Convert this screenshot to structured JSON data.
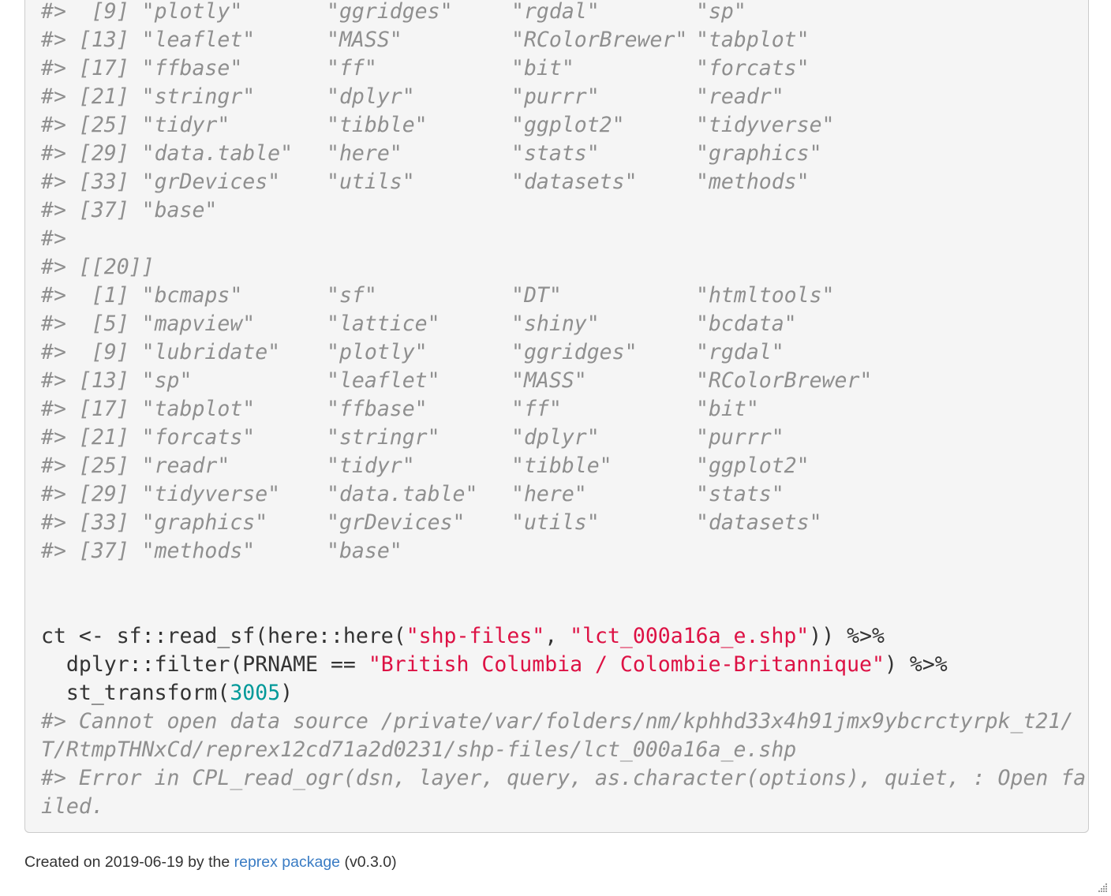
{
  "output_prefix": "#>",
  "output_rows_a": [
    {
      "index": " [9]",
      "items": [
        "\"plotly\"",
        "\"ggridges\"",
        "\"rgdal\"",
        "\"sp\""
      ]
    },
    {
      "index": "[13]",
      "items": [
        "\"leaflet\"",
        "\"MASS\"",
        "\"RColorBrewer\"",
        "\"tabplot\""
      ]
    },
    {
      "index": "[17]",
      "items": [
        "\"ffbase\"",
        "\"ff\"",
        "\"bit\"",
        "\"forcats\""
      ]
    },
    {
      "index": "[21]",
      "items": [
        "\"stringr\"",
        "\"dplyr\"",
        "\"purrr\"",
        "\"readr\""
      ]
    },
    {
      "index": "[25]",
      "items": [
        "\"tidyr\"",
        "\"tibble\"",
        "\"ggplot2\"",
        "\"tidyverse\""
      ]
    },
    {
      "index": "[29]",
      "items": [
        "\"data.table\"",
        "\"here\"",
        "\"stats\"",
        "\"graphics\""
      ]
    },
    {
      "index": "[33]",
      "items": [
        "\"grDevices\"",
        "\"utils\"",
        "\"datasets\"",
        "\"methods\""
      ]
    },
    {
      "index": "[37]",
      "items": [
        "\"base\"",
        "",
        "",
        ""
      ]
    }
  ],
  "output_blank": "#>",
  "output_list_header": "#> [[20]]",
  "output_rows_b": [
    {
      "index": " [1]",
      "items": [
        "\"bcmaps\"",
        "\"sf\"",
        "\"DT\"",
        "\"htmltools\""
      ]
    },
    {
      "index": " [5]",
      "items": [
        "\"mapview\"",
        "\"lattice\"",
        "\"shiny\"",
        "\"bcdata\""
      ]
    },
    {
      "index": " [9]",
      "items": [
        "\"lubridate\"",
        "\"plotly\"",
        "\"ggridges\"",
        "\"rgdal\""
      ]
    },
    {
      "index": "[13]",
      "items": [
        "\"sp\"",
        "\"leaflet\"",
        "\"MASS\"",
        "\"RColorBrewer\""
      ]
    },
    {
      "index": "[17]",
      "items": [
        "\"tabplot\"",
        "\"ffbase\"",
        "\"ff\"",
        "\"bit\""
      ]
    },
    {
      "index": "[21]",
      "items": [
        "\"forcats\"",
        "\"stringr\"",
        "\"dplyr\"",
        "\"purrr\""
      ]
    },
    {
      "index": "[25]",
      "items": [
        "\"readr\"",
        "\"tidyr\"",
        "\"tibble\"",
        "\"ggplot2\""
      ]
    },
    {
      "index": "[29]",
      "items": [
        "\"tidyverse\"",
        "\"data.table\"",
        "\"here\"",
        "\"stats\""
      ]
    },
    {
      "index": "[33]",
      "items": [
        "\"graphics\"",
        "\"grDevices\"",
        "\"utils\"",
        "\"datasets\""
      ]
    },
    {
      "index": "[37]",
      "items": [
        "\"methods\"",
        "\"base\"",
        "",
        ""
      ]
    }
  ],
  "code": {
    "line1": {
      "a": "ct <- sf::read_sf(here::here(",
      "s1": "\"shp-files\"",
      "b": ", ",
      "s2": "\"lct_000a16a_e.shp\"",
      "c": ")) %>%"
    },
    "line2": {
      "a": "  dplyr::filter(PRNAME == ",
      "s1": "\"British Columbia / Colombie-Britannique\"",
      "c": ") %>%"
    },
    "line3": {
      "a": "  st_transform(",
      "n": "3005",
      "c": ")"
    }
  },
  "errors": [
    "#> Cannot open data source /private/var/folders/nm/kphhd33x4h91jmx9ybcrctyrpk_t21/",
    "T/RtmpTHNxCd/reprex12cd71a2d0231/shp-files/lct_000a16a_e.shp",
    "#> Error in CPL_read_ogr(dsn, layer, query, as.character(options), quiet, : Open fa",
    "iled."
  ],
  "caption": {
    "prefix": "Created on 2019-06-19 by the ",
    "link": "reprex package",
    "suffix": " (v0.3.0)"
  }
}
